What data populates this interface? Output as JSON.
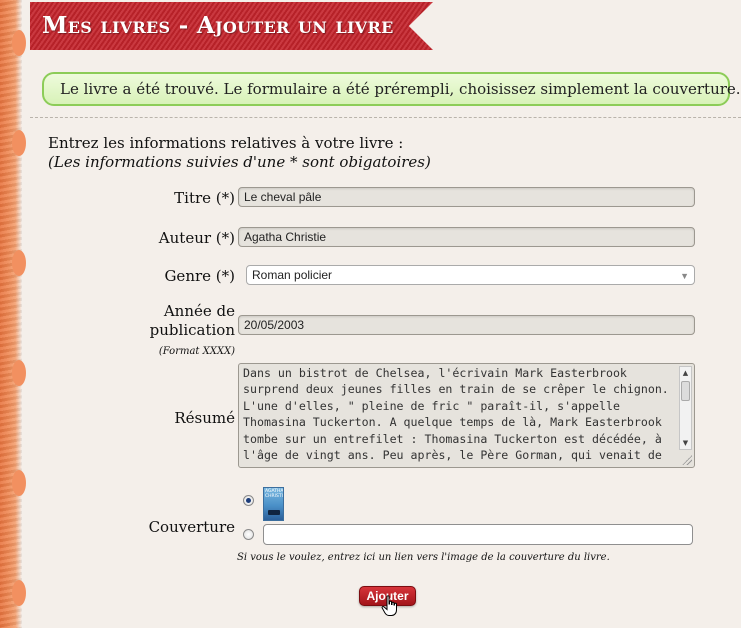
{
  "header": {
    "title": "Mes livres - Ajouter un livre"
  },
  "notice": {
    "icon": "check-icon",
    "message": "Le livre a été trouvé. Le formulaire a été prérempli, choisissez simplement la couverture."
  },
  "intro": {
    "line1": "Entrez les informations relatives à votre livre :",
    "line2": "(Les informations suivies d'une * sont obigatoires)"
  },
  "form": {
    "titre": {
      "label": "Titre (*)",
      "value": "Le cheval pâle"
    },
    "auteur": {
      "label": "Auteur (*)",
      "value": "Agatha Christie"
    },
    "genre": {
      "label": "Genre (*)",
      "selected": "Roman policier"
    },
    "annee": {
      "label_line1": "Année de",
      "label_line2": "publication",
      "hint": "(Format XXXX)",
      "value": "20/05/2003"
    },
    "resume": {
      "label": "Résumé",
      "value": "Dans un bistrot de Chelsea, l'écrivain Mark Easterbrook surprend deux jeunes filles en train de se crêper le chignon. L'une d'elles, \" pleine de fric \" paraît-il, s'appelle Thomasina Tuckerton. A quelque temps de là, Mark Easterbrook tombe sur un entrefilet : Thomasina Tuckerton est décédée, à l'âge de vingt ans. Peu après, le Père Gorman, qui venait de"
    },
    "couverture": {
      "label": "Couverture",
      "thumb_caption": "AGATHA CHRISTIE",
      "selected_option": "thumbnail",
      "url_value": "",
      "hint": "Si vous le voulez, entrez ici un lien vers l'image de la couverture du livre."
    },
    "submit_label": "Ajouter"
  },
  "colors": {
    "ribbon": "#c4232b",
    "notice_border": "#8ccc58",
    "button": "#b8222a"
  }
}
